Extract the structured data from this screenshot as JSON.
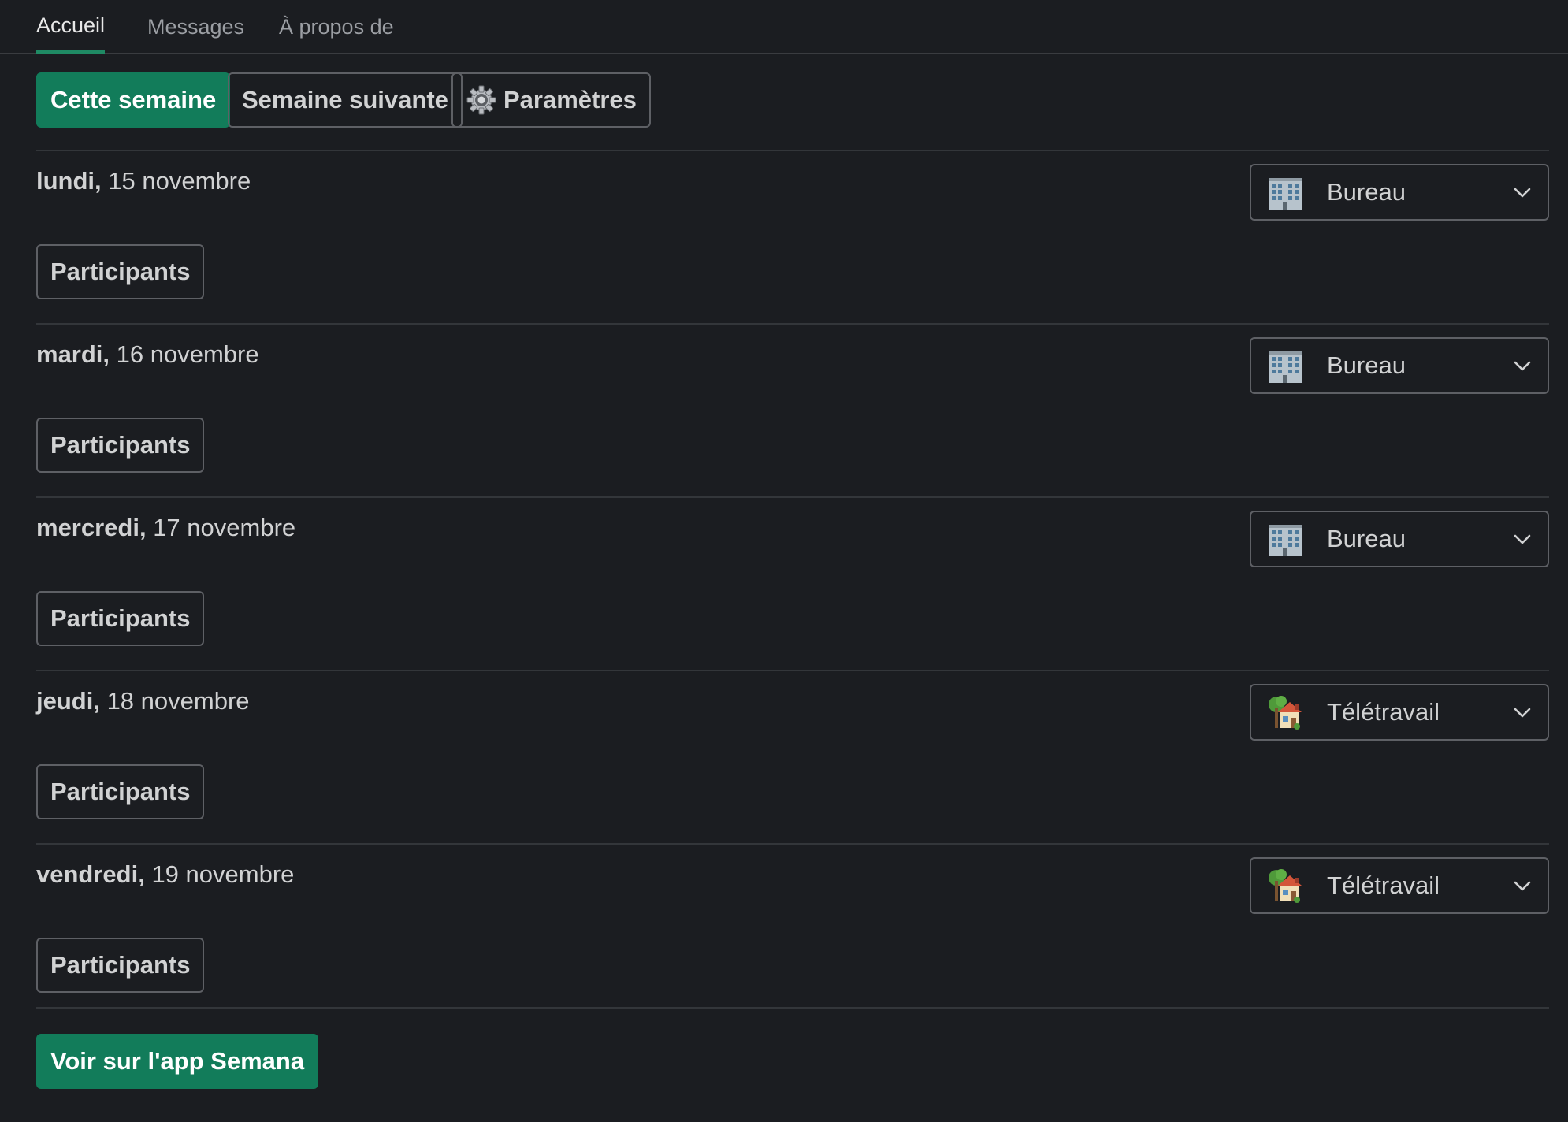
{
  "tabs": [
    {
      "label": "Accueil",
      "active": true
    },
    {
      "label": "Messages",
      "active": false
    },
    {
      "label": "À propos de",
      "active": false
    }
  ],
  "toolbar": {
    "this_week": "Cette semaine",
    "next_week": "Semaine suivante",
    "settings": "Paramètres"
  },
  "days": [
    {
      "weekday": "lundi,",
      "date": " 15 novembre",
      "status": "Bureau",
      "status_icon": "office-building-icon",
      "participants": "Participants"
    },
    {
      "weekday": "mardi,",
      "date": " 16 novembre",
      "status": "Bureau",
      "status_icon": "office-building-icon",
      "participants": "Participants"
    },
    {
      "weekday": "mercredi,",
      "date": " 17 novembre",
      "status": "Bureau",
      "status_icon": "office-building-icon",
      "participants": "Participants"
    },
    {
      "weekday": "jeudi,",
      "date": " 18 novembre",
      "status": "Télétravail",
      "status_icon": "house-with-garden-icon",
      "participants": "Participants"
    },
    {
      "weekday": "vendredi,",
      "date": " 19 novembre",
      "status": "Télétravail",
      "status_icon": "house-with-garden-icon",
      "participants": "Participants"
    }
  ],
  "footer": {
    "open_app": "Voir sur l'app Semana"
  },
  "colors": {
    "background": "#1b1d21",
    "accent": "#127c5a",
    "border": "#5e6065",
    "tab_underline": "#1f8a64"
  }
}
